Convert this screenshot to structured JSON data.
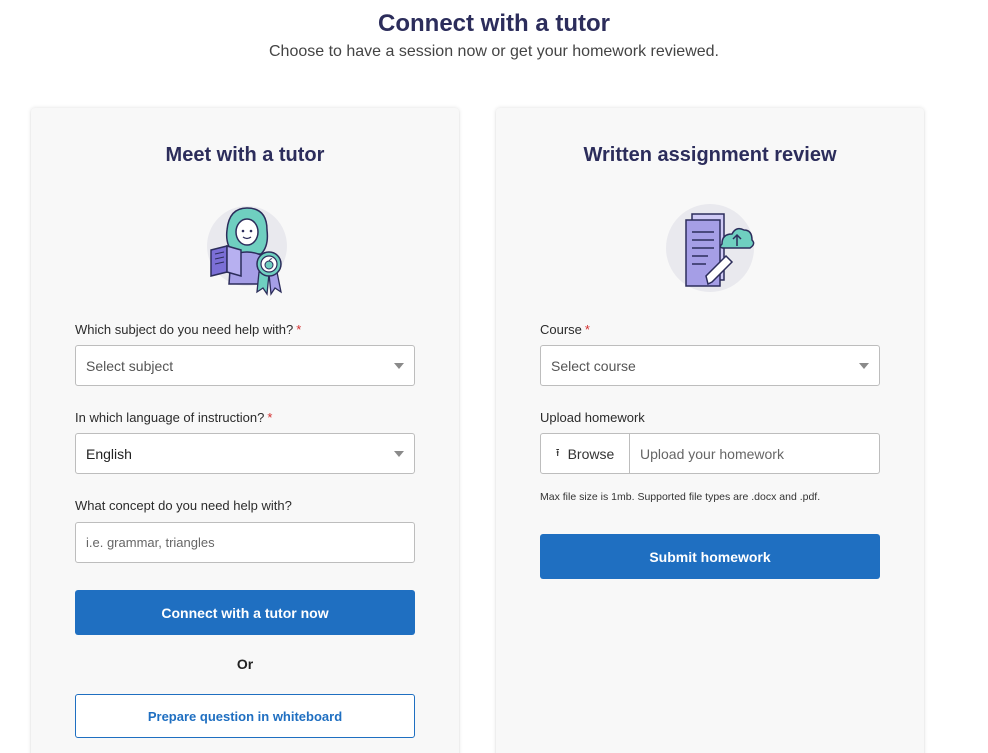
{
  "header": {
    "title": "Connect with a tutor",
    "subtitle": "Choose to have a session now or get your homework reviewed."
  },
  "meet": {
    "title": "Meet with a tutor",
    "illustration_icon": "tutor-with-book-and-badge-icon",
    "subject_label": "Which subject do you need help with?",
    "subject_required": "*",
    "subject_placeholder": "Select subject",
    "language_label": "In which language of instruction?",
    "language_required": "*",
    "language_value": "English",
    "concept_label": "What concept do you need help with?",
    "concept_placeholder": "i.e. grammar, triangles",
    "connect_button": "Connect with a tutor now",
    "or_text": "Or",
    "whiteboard_button": "Prepare question in whiteboard"
  },
  "review": {
    "title": "Written assignment review",
    "illustration_icon": "document-upload-icon",
    "course_label": "Course",
    "course_required": "*",
    "course_placeholder": "Select course",
    "upload_label": "Upload homework",
    "browse_label": "Browse",
    "browse_icon": "upload-arrow-icon",
    "upload_placeholder": "Upload your homework",
    "hint": "Max file size is 1mb. Supported file types are .docx and .pdf.",
    "submit_button": "Submit homework"
  },
  "colors": {
    "primary": "#1f6fc1",
    "heading": "#2c2d5b",
    "required": "#d32f2f",
    "card_bg": "#f8f8f8"
  }
}
